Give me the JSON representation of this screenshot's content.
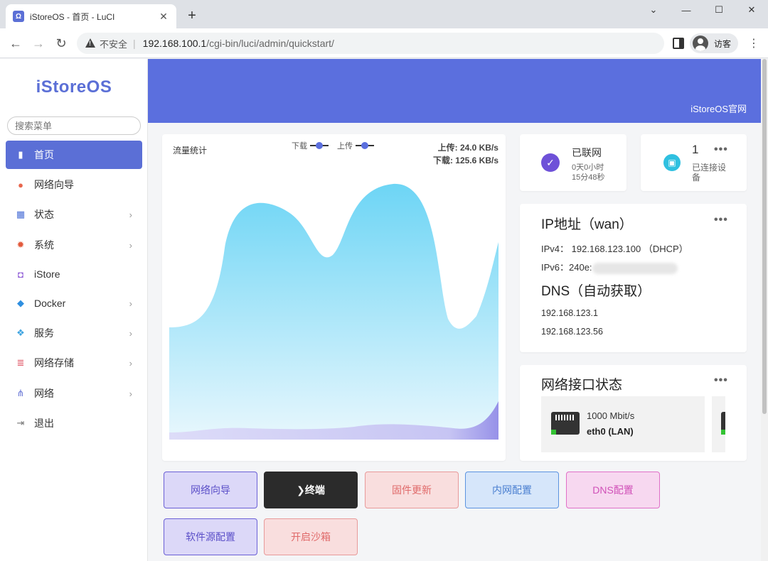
{
  "browser": {
    "tab_title": "iStoreOS - 首页 - LuCI",
    "tab_favicon": "Ω",
    "close_glyph": "✕",
    "new_tab_glyph": "+",
    "insecure_label": "不安全",
    "url_host": "192.168.100.1",
    "url_path": "/cgi-bin/luci/admin/quickstart/",
    "profile_label": "访客"
  },
  "sidebar": {
    "logo": "iStoreOS",
    "search_placeholder": "搜索菜单",
    "items": [
      {
        "label": "首页",
        "icon": "bar-chart-icon",
        "glyph": "▮",
        "color": "#ffffff",
        "active": true,
        "chevron": false
      },
      {
        "label": "网络向导",
        "icon": "globe-icon",
        "glyph": "●",
        "color": "#e8664c",
        "active": false,
        "chevron": false
      },
      {
        "label": "状态",
        "icon": "grid-icon",
        "glyph": "▦",
        "color": "#4a6fd6",
        "active": false,
        "chevron": true
      },
      {
        "label": "系统",
        "icon": "gear-icon",
        "glyph": "✹",
        "color": "#e25a3c",
        "active": false,
        "chevron": true
      },
      {
        "label": "iStore",
        "icon": "store-icon",
        "glyph": "◘",
        "color": "#8e5bd6",
        "active": false,
        "chevron": false
      },
      {
        "label": "Docker",
        "icon": "docker-icon",
        "glyph": "◆",
        "color": "#2f8fe0",
        "active": false,
        "chevron": true
      },
      {
        "label": "服务",
        "icon": "services-icon",
        "glyph": "❖",
        "color": "#3fa4e0",
        "active": false,
        "chevron": true
      },
      {
        "label": "网络存储",
        "icon": "storage-icon",
        "glyph": "≣",
        "color": "#e05a6a",
        "active": false,
        "chevron": true
      },
      {
        "label": "网络",
        "icon": "network-icon",
        "glyph": "⋔",
        "color": "#6a78d6",
        "active": false,
        "chevron": true
      },
      {
        "label": "退出",
        "icon": "logout-icon",
        "glyph": "⇥",
        "color": "#777777",
        "active": false,
        "chevron": false
      }
    ],
    "chevron_glyph": "›"
  },
  "banner": {
    "link": "iStoreOS官网",
    "color": "#5b6fde"
  },
  "traffic": {
    "title": "流量统计",
    "legend_download": "下载",
    "legend_upload": "上传",
    "upload_rate": "上传: 24.0 KB/s",
    "download_rate": "下载: 125.6 KB/s"
  },
  "online": {
    "title": "已联网",
    "sub1": "0天0小时",
    "sub2": "15分48秒",
    "icon_glyph": "✓",
    "icon_color": "#6e51d8"
  },
  "devices": {
    "count": "1",
    "label_line1": "已连接设",
    "label_line2": "备",
    "icon_glyph": "▣",
    "icon_color": "#2fc0e0",
    "dots": "•••"
  },
  "ip": {
    "heading": "IP地址（wan）",
    "ipv4": "IPv4： 192.168.123.100 （DHCP）",
    "ipv6_prefix": "IPv6：240e:",
    "dns_heading": "DNS（自动获取）",
    "dns": [
      "192.168.123.1",
      "192.168.123.56"
    ],
    "dots": "•••"
  },
  "net": {
    "heading": "网络接口状态",
    "port_speed": "1000 Mbit/s",
    "port_name": "eth0 (LAN)",
    "dots": "•••"
  },
  "actions": [
    {
      "label": "网络向导",
      "bg": "#dcd8f8",
      "border": "#6a5fd6",
      "color": "#5b4fc8"
    },
    {
      "label": "❯终端",
      "bg": "#2b2b2b",
      "border": "#2b2b2b",
      "color": "#ffffff"
    },
    {
      "label": "固件更新",
      "bg": "#f9dede",
      "border": "#e89a9a",
      "color": "#e06a6a"
    },
    {
      "label": "内网配置",
      "bg": "#d6e6fa",
      "border": "#5b93e0",
      "color": "#4a7fd0"
    },
    {
      "label": "DNS配置",
      "bg": "#f7d8f0",
      "border": "#e070c8",
      "color": "#d050b8"
    },
    {
      "label": "软件源配置",
      "bg": "#dcd8f8",
      "border": "#6a5fd6",
      "color": "#5b4fc8"
    },
    {
      "label": "开启沙箱",
      "bg": "#f9dede",
      "border": "#e89a9a",
      "color": "#e06a6a"
    }
  ]
}
